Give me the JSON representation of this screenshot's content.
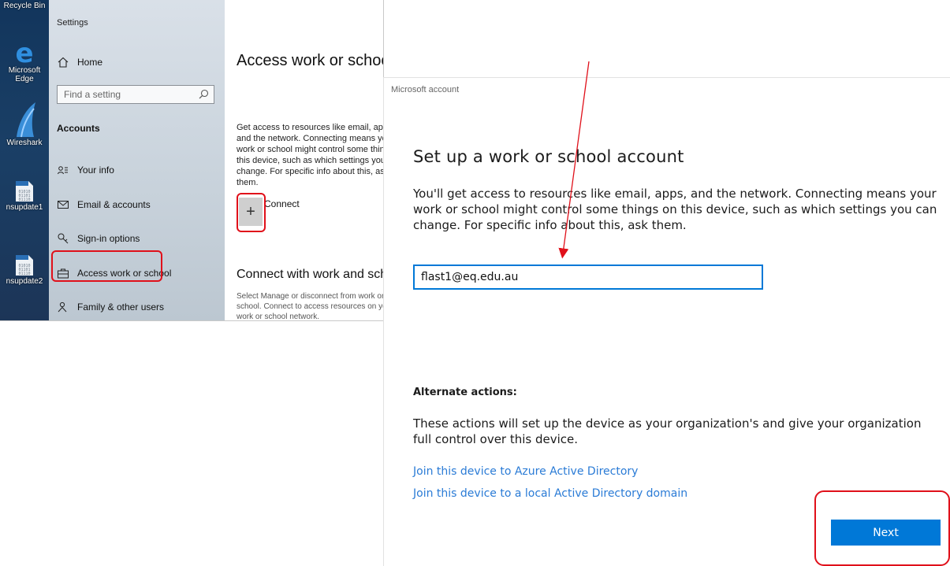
{
  "desktop": {
    "icons": [
      {
        "label": "Recycle Bin",
        "icon": "recycle-bin-icon"
      },
      {
        "label": "Microsoft Edge",
        "icon": "edge-icon"
      },
      {
        "label": "Wireshark",
        "icon": "wireshark-icon"
      },
      {
        "label": "nsupdate1",
        "icon": "binary-file-icon"
      },
      {
        "label": "nsupdate2",
        "icon": "binary-file-icon"
      }
    ]
  },
  "settings": {
    "app_title": "Settings",
    "home_label": "Home",
    "search_placeholder": "Find a setting",
    "section": "Accounts",
    "nav": [
      {
        "label": "Your info",
        "icon": "person-info-icon"
      },
      {
        "label": "Email & accounts",
        "icon": "mail-icon"
      },
      {
        "label": "Sign-in options",
        "icon": "key-icon"
      },
      {
        "label": "Access work or school",
        "icon": "briefcase-icon",
        "selected": true
      },
      {
        "label": "Family & other users",
        "icon": "people-icon"
      }
    ],
    "main": {
      "title": "Access work or school",
      "description": "Get access to resources like email, apps, and the network. Connecting means your work or school might control some things on this device, such as which settings you can change. For specific info about this, ask them.",
      "connect_label": "Connect",
      "subtitle": "Connect with work and school",
      "subdescription": "Select Manage or disconnect from work or school. Connect to access resources on your work or school network."
    }
  },
  "dialog": {
    "caption": "Microsoft account",
    "title": "Set up a work or school account",
    "description": "You'll get access to resources like email, apps, and the network. Connecting means your work or school might control some things on this device, such as which settings you can change. For specific info about this, ask them.",
    "email_value": "flast1@eq.edu.au",
    "alternate_heading": "Alternate actions:",
    "alternate_description": "These actions will set up the device as your organization's and give your organization full control over this device.",
    "links": [
      "Join this device to Azure Active Directory",
      "Join this device to a local Active Directory domain"
    ],
    "next_label": "Next"
  },
  "colors": {
    "accent": "#0078d7",
    "annotation_red": "#e0101a",
    "link": "#2a7bd6"
  }
}
